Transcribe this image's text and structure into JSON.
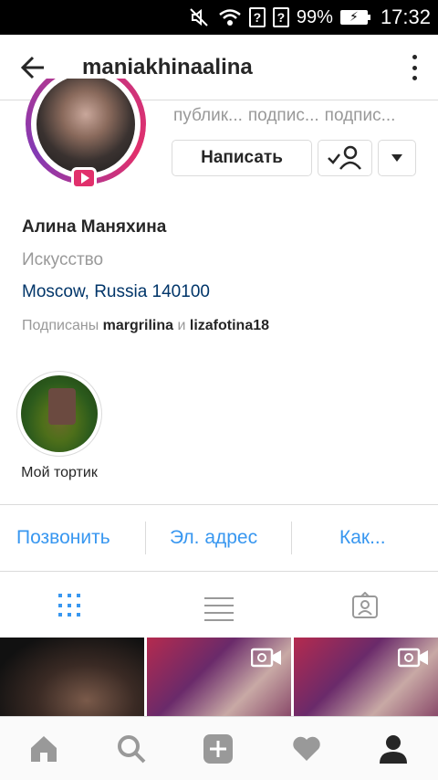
{
  "status_bar": {
    "battery": "99%",
    "time": "17:32"
  },
  "app_bar": {
    "username": "maniakhinaalina"
  },
  "profile": {
    "stats": [
      "публик...",
      "подпис...",
      "подпис..."
    ],
    "message_button": "Написать"
  },
  "bio": {
    "name": "Алина Маняхина",
    "category": "Искусство",
    "location": "Moscow, Russia 140100",
    "followed_by_prefix": "Подписаны",
    "followed_by_1": "margrilina",
    "followed_by_and": "и",
    "followed_by_2": "lizafotina18"
  },
  "highlight": {
    "label": "Мой тортик"
  },
  "contact": {
    "call": "Позвонить",
    "email": "Эл. адрес",
    "directions": "Как..."
  },
  "colors": {
    "link": "#3897f0",
    "location": "#003569",
    "ring": "#c13584",
    "muted": "#999999"
  },
  "icons": [
    "back-arrow-icon",
    "more-vertical-icon",
    "grid-icon",
    "list-icon",
    "tagged-icon",
    "home-icon",
    "search-icon",
    "add-icon",
    "heart-icon",
    "profile-icon",
    "video-icon"
  ]
}
